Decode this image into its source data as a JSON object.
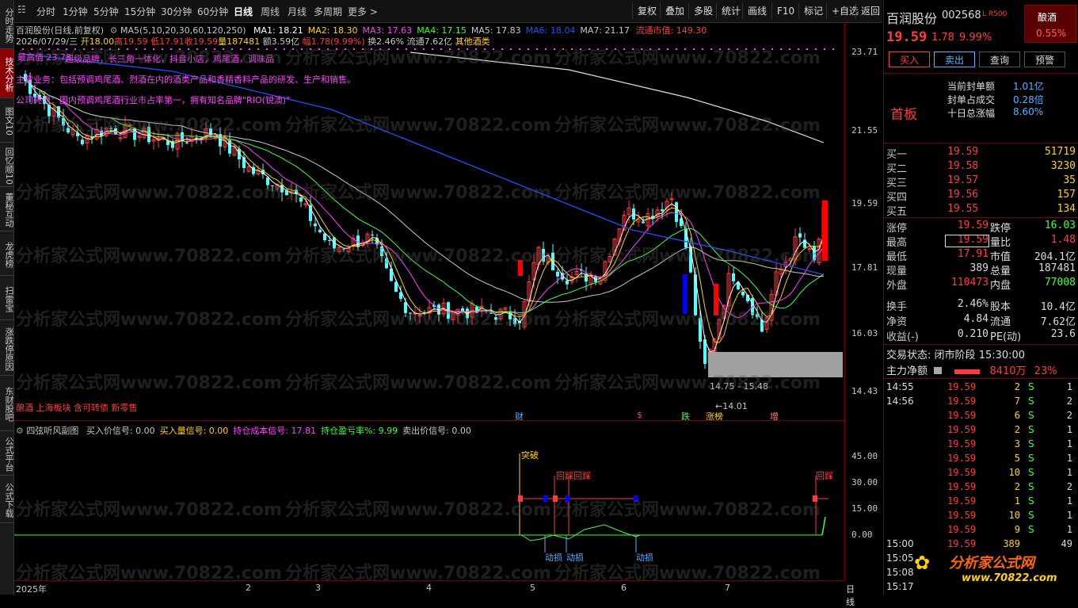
{
  "left_tabs": [
    "分时走势",
    "技术分析",
    "图文10",
    "回忆顺10",
    "董秘互动",
    "龙虎榜",
    "扫雷宝",
    "涨跌停原因",
    "东财股吧",
    "公式平台",
    "公式下载"
  ],
  "left_active": 1,
  "toolbar": {
    "periods": [
      "分时",
      "1分钟",
      "5分钟",
      "15分钟",
      "30分钟",
      "60分钟",
      "日线",
      "周线",
      "月线",
      "多周期",
      "更多 >"
    ],
    "selected_period": 6,
    "buttons": [
      "复权",
      "叠加",
      "多股",
      "统计",
      "画线",
      "F10",
      "标记",
      "+自选",
      "返回"
    ]
  },
  "main_info": {
    "line1_name": "百润股份(日线,前复权)",
    "line1_ma_label": "MA5(5,10,20,30,60,120,250)",
    "ma": [
      {
        "label": "MA1: 18.21",
        "color": "#ffffff"
      },
      {
        "label": "MA2: 18.30",
        "color": "#ffd400"
      },
      {
        "label": "MA3: 17.63",
        "color": "#ff40ff"
      },
      {
        "label": "MA4: 17.15",
        "color": "#40ff40"
      },
      {
        "label": "MA5: 17.83",
        "color": "#c8c8c8"
      },
      {
        "label": "MA6: 18.04",
        "color": "#2050ff"
      },
      {
        "label": "MA7: 21.17",
        "color": "#c8c8c8"
      }
    ],
    "circ_value": "流通市值: 149.30",
    "line2": {
      "date": "2026/07/29/三",
      "open": "开18.00",
      "high": "高19.59",
      "low": "低17.91",
      "close": "收19.59",
      "vol": "量187481",
      "amt": "额3.59亿",
      "chg": "幅1.78(9.99%)",
      "turn": "换2.46%",
      "float": "流通7.62亿",
      "sector": "其他酒类"
    },
    "notes": [
      "最高值 23.73",
      "超级品牌，长三角一体化，抖音小店，鸡尾酒，调味品",
      "主营业务：包括预调鸡尾酒、烈酒在内的酒类产品和香精香料产品的研发、生产和销售。",
      "公司亮点：国内预调鸡尾酒行业市占率第一，拥有知名品牌\"RIO(锐澳)\""
    ],
    "sector_tags": "酿酒 上海板块 含可转债 新零售",
    "range_label": "14.75 - 15.48",
    "low_label": "14.01",
    "event_tags": [
      "财",
      "$",
      "跌",
      "涨榜",
      "增"
    ]
  },
  "y_axis_main": [
    "23.71",
    "21.55",
    "19.59",
    "17.81",
    "16.03",
    "14.43"
  ],
  "y_axis_sub": [
    "45.00",
    "30.00",
    "15.00",
    "0.00"
  ],
  "x_axis": [
    "2025年",
    "2",
    "3",
    "4",
    "5",
    "6",
    "7"
  ],
  "x_axis_right": "日线",
  "sub_info": {
    "name": "四弦听风副图",
    "items": [
      {
        "label": "买入价信号: 0.00",
        "color": "#c8c8c8"
      },
      {
        "label": "买入量信号: 0.00",
        "color": "#ffd400"
      },
      {
        "label": "持仓成本信号: 17.81",
        "color": "#ff40ff"
      },
      {
        "label": "持仓盈亏率%: 9.99",
        "color": "#40ff40"
      },
      {
        "label": "卖出价信号: 0.00",
        "color": "#c8c8c8"
      }
    ],
    "annotations": [
      "突破",
      "回踩",
      "回踩",
      "回踩",
      "动损",
      "动损",
      "动损"
    ]
  },
  "right_panel": {
    "name": "百润股份",
    "code": "002568",
    "tags": "L R500",
    "sector": "酿酒",
    "sector_chg": "0.55%",
    "price": "19.59",
    "chg": "1.78",
    "pct": "9.99%",
    "buttons": [
      "买入",
      "卖出",
      "查询",
      "预警"
    ],
    "seal": [
      {
        "label": "当前封单额",
        "value": "1.01亿"
      },
      {
        "label": "封单占成交",
        "value": "0.28倍"
      },
      {
        "label": "十日总涨幅",
        "value": "8.60%"
      }
    ],
    "first_board": "首板",
    "bids": [
      {
        "label": "买一",
        "price": "19.59",
        "qty": "51719"
      },
      {
        "label": "买二",
        "price": "19.58",
        "qty": "3230"
      },
      {
        "label": "买三",
        "price": "19.57",
        "qty": "35"
      },
      {
        "label": "买四",
        "price": "19.56",
        "qty": "157"
      },
      {
        "label": "买五",
        "price": "19.55",
        "qty": "134"
      }
    ],
    "stats": [
      {
        "l1": "涨停",
        "v1": "19.59",
        "l2": "跌停",
        "v2": "16.03"
      },
      {
        "l1": "最高",
        "v1": "19.59",
        "l2": "量比",
        "v2": "1.48"
      },
      {
        "l1": "最低",
        "v1": "17.91",
        "l2": "市值",
        "v2": "204.1亿"
      },
      {
        "l1": "现量",
        "v1": "389",
        "l2": "总量",
        "v2": "187481"
      },
      {
        "l1": "外盘",
        "v1": "110473",
        "l2": "内盘",
        "v2": "77008"
      },
      {
        "l1": "换手",
        "v1": "2.46%",
        "l2": "股本",
        "v2": "10.4亿"
      },
      {
        "l1": "净资",
        "v1": "4.84",
        "l2": "流通",
        "v2": "7.62亿"
      },
      {
        "l1": "收益(-)",
        "v1": "0.210",
        "l2": "PE(动)",
        "v2": "23.6"
      }
    ],
    "trade_status_label": "交易状态:",
    "trade_status": "闭市阶段",
    "trade_time": "15:30:00",
    "main_flow_label": "主力净额",
    "main_flow_value": "8410万",
    "main_flow_pct": "23%",
    "ticks": [
      {
        "t": "14:55",
        "p": "19.59",
        "q": "2",
        "s": "S",
        "n": "1"
      },
      {
        "t": "14:56",
        "p": "19.59",
        "q": "7",
        "s": "S",
        "n": "2"
      },
      {
        "t": "",
        "p": "19.59",
        "q": "6",
        "s": "S",
        "n": "2"
      },
      {
        "t": "",
        "p": "19.59",
        "q": "2",
        "s": "S",
        "n": "1"
      },
      {
        "t": "",
        "p": "19.59",
        "q": "3",
        "s": "S",
        "n": "1"
      },
      {
        "t": "",
        "p": "19.59",
        "q": "5",
        "s": "S",
        "n": "1"
      },
      {
        "t": "",
        "p": "19.59",
        "q": "10",
        "s": "S",
        "n": "1"
      },
      {
        "t": "",
        "p": "19.59",
        "q": "2",
        "s": "S",
        "n": "2"
      },
      {
        "t": "",
        "p": "19.59",
        "q": "1",
        "s": "S",
        "n": "1"
      },
      {
        "t": "",
        "p": "19.59",
        "q": "10",
        "s": "S",
        "n": "1"
      },
      {
        "t": "",
        "p": "19.59",
        "q": "9",
        "s": "S",
        "n": "1"
      },
      {
        "t": "15:00",
        "p": "19.59",
        "q": "389",
        "s": "",
        "n": "49"
      },
      {
        "t": "15:05",
        "p": "",
        "q": "",
        "s": "",
        "n": ""
      },
      {
        "t": "15:08",
        "p": "",
        "q": "",
        "s": "",
        "n": ""
      },
      {
        "t": "15:17",
        "p": "",
        "q": "",
        "s": "",
        "n": ""
      }
    ],
    "logo_text": "分析家公式网",
    "logo_url": "www.70822.com"
  },
  "watermark": "分析家公式网www.70822.com"
}
